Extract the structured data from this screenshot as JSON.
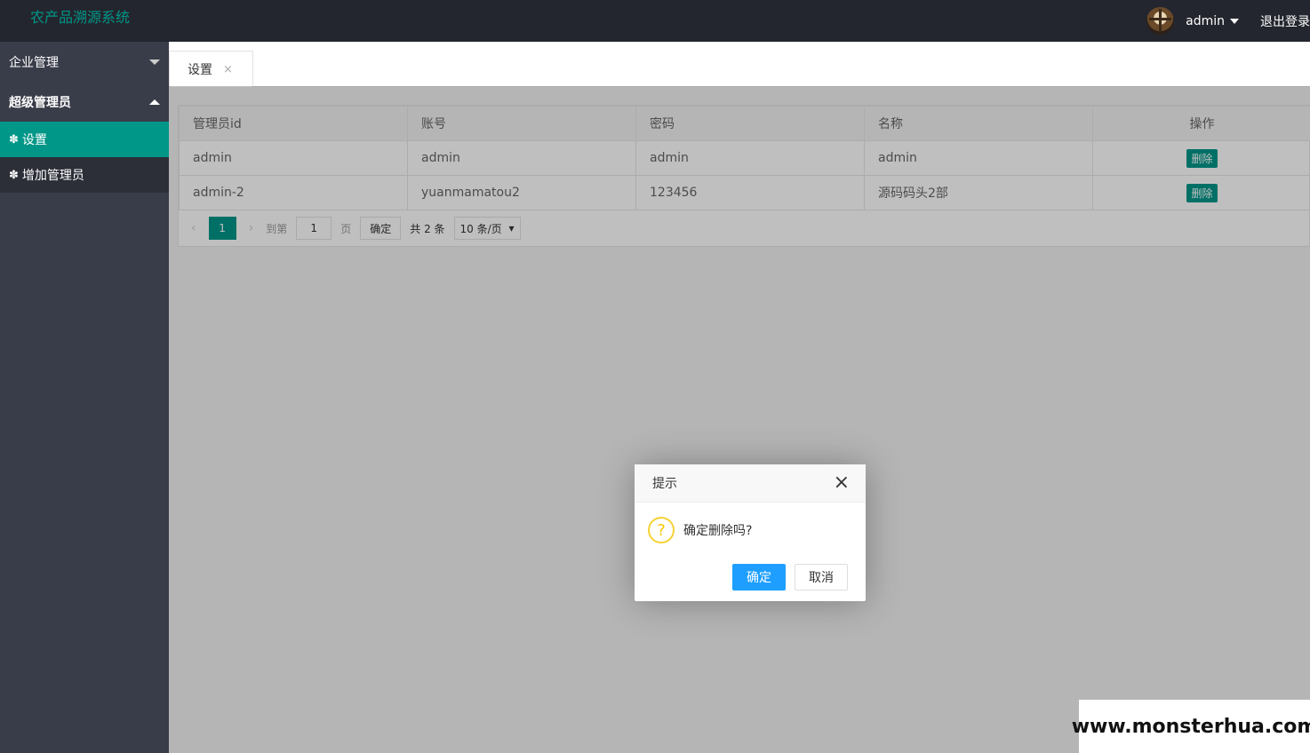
{
  "header": {
    "logo": "农产品溯源系统",
    "user_name": "admin",
    "logout": "退出登录"
  },
  "sidebar": {
    "groups": [
      {
        "label": "企业管理"
      },
      {
        "label": "超级管理员",
        "items": [
          {
            "label": "设置",
            "icon": "gear-icon"
          },
          {
            "label": "增加管理员",
            "icon": "gear-icon"
          }
        ]
      }
    ]
  },
  "tabs": [
    {
      "label": "设置",
      "close": "×"
    }
  ],
  "table": {
    "headers": [
      "管理员id",
      "账号",
      "密码",
      "名称",
      "操作"
    ],
    "rows": [
      {
        "id": "admin",
        "account": "admin",
        "password": "admin",
        "name": "admin",
        "action": "删除"
      },
      {
        "id": "admin-2",
        "account": "yuanmamatou2",
        "password": "123456",
        "name": "源码码头2部",
        "action": "删除"
      }
    ]
  },
  "pager": {
    "current": "1",
    "goto_prefix": "到第",
    "goto_value": "1",
    "goto_suffix": "页",
    "confirm": "确定",
    "total": "共 2 条",
    "limit": "10 条/页"
  },
  "dialog": {
    "title": "提示",
    "message": "确定删除吗?",
    "ok": "确定",
    "cancel": "取消"
  },
  "watermark": "www.monsterhua.com",
  "colors": {
    "accent": "#009688",
    "primary_btn": "#1e9fff",
    "sidebar_bg": "#393d49",
    "header_bg": "#23262e"
  }
}
